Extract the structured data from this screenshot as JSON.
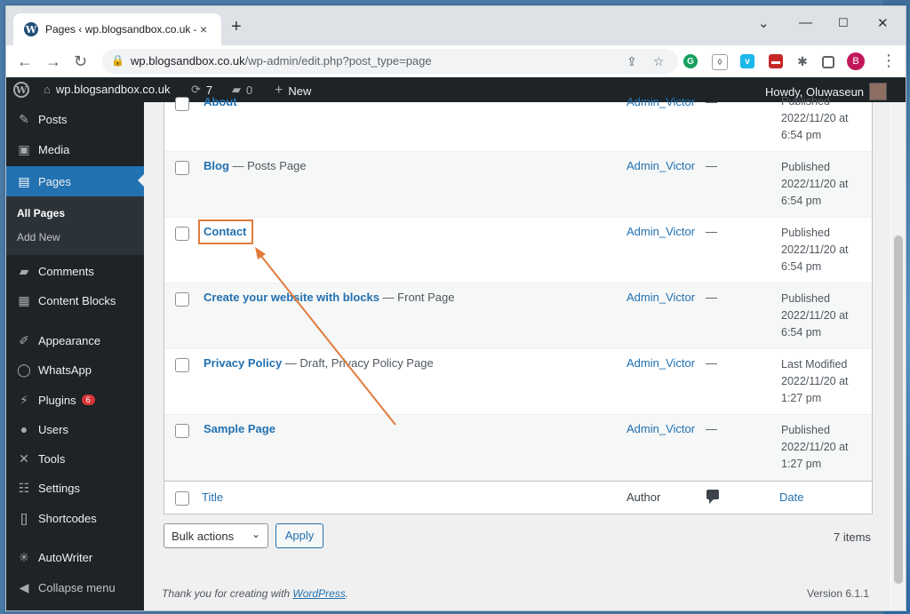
{
  "browser": {
    "tab_title": "Pages ‹ wp.blogsandbox.co.uk —",
    "tab_close": "×",
    "new_tab": "+",
    "url_host": "wp.blogsandbox.co.uk",
    "url_path": "/wp-admin/edit.php?post_type=page",
    "profile_initial": "B"
  },
  "adminbar": {
    "site_name": "wp.blogsandbox.co.uk",
    "updates_count": "7",
    "comments_count": "0",
    "new_label": "New",
    "greeting": "Howdy, Oluwaseun"
  },
  "sidebar": {
    "items": [
      {
        "label": "Posts",
        "icon": "pin-icon"
      },
      {
        "label": "Media",
        "icon": "media-icon"
      },
      {
        "label": "Pages",
        "icon": "pages-icon"
      },
      {
        "label": "Comments",
        "icon": "comments-icon"
      },
      {
        "label": "Content Blocks",
        "icon": "blocks-icon"
      },
      {
        "label": "Appearance",
        "icon": "brush-icon"
      },
      {
        "label": "WhatsApp",
        "icon": "whatsapp-icon"
      },
      {
        "label": "Plugins",
        "icon": "plugin-icon"
      },
      {
        "label": "Users",
        "icon": "users-icon"
      },
      {
        "label": "Tools",
        "icon": "wrench-icon"
      },
      {
        "label": "Settings",
        "icon": "settings-icon"
      },
      {
        "label": "Shortcodes",
        "icon": "brackets-icon"
      },
      {
        "label": "AutoWriter",
        "icon": "spider-icon"
      },
      {
        "label": "Collapse menu",
        "icon": "collapse-icon"
      }
    ],
    "submenu": [
      "All Pages",
      "Add New"
    ],
    "plugins_badge": "6"
  },
  "table": {
    "rows": [
      {
        "title": "About",
        "suffix": "",
        "author": "Admin_Victor",
        "comments": "—",
        "status": "Published",
        "date": "2022/11/20 at",
        "time": "6:54 pm"
      },
      {
        "title": "Blog",
        "suffix": " — Posts Page",
        "author": "Admin_Victor",
        "comments": "—",
        "status": "Published",
        "date": "2022/11/20 at",
        "time": "6:54 pm"
      },
      {
        "title": "Contact",
        "suffix": "",
        "author": "Admin_Victor",
        "comments": "—",
        "status": "Published",
        "date": "2022/11/20 at",
        "time": "6:54 pm"
      },
      {
        "title": "Create your website with blocks",
        "suffix": " — Front Page",
        "author": "Admin_Victor",
        "comments": "—",
        "status": "Published",
        "date": "2022/11/20 at",
        "time": "6:54 pm"
      },
      {
        "title": "Privacy Policy",
        "suffix": " — Draft, Privacy Policy Page",
        "author": "Admin_Victor",
        "comments": "—",
        "status": "Last Modified",
        "date": "2022/11/20 at",
        "time": "1:27 pm"
      },
      {
        "title": "Sample Page",
        "suffix": "",
        "author": "Admin_Victor",
        "comments": "—",
        "status": "Published",
        "date": "2022/11/20 at",
        "time": "1:27 pm"
      }
    ],
    "footer": {
      "title": "Title",
      "author": "Author",
      "date": "Date"
    }
  },
  "actions": {
    "bulk_label": "Bulk actions",
    "apply_label": "Apply",
    "items_count": "7 items"
  },
  "footer": {
    "thanks_prefix": "Thank you for creating with ",
    "thanks_link": "WordPress",
    "thanks_suffix": ".",
    "version": "Version 6.1.1"
  },
  "colors": {
    "accent": "#2271b1",
    "sidebar_bg": "#1d2327",
    "highlight": "#e07a3a"
  }
}
